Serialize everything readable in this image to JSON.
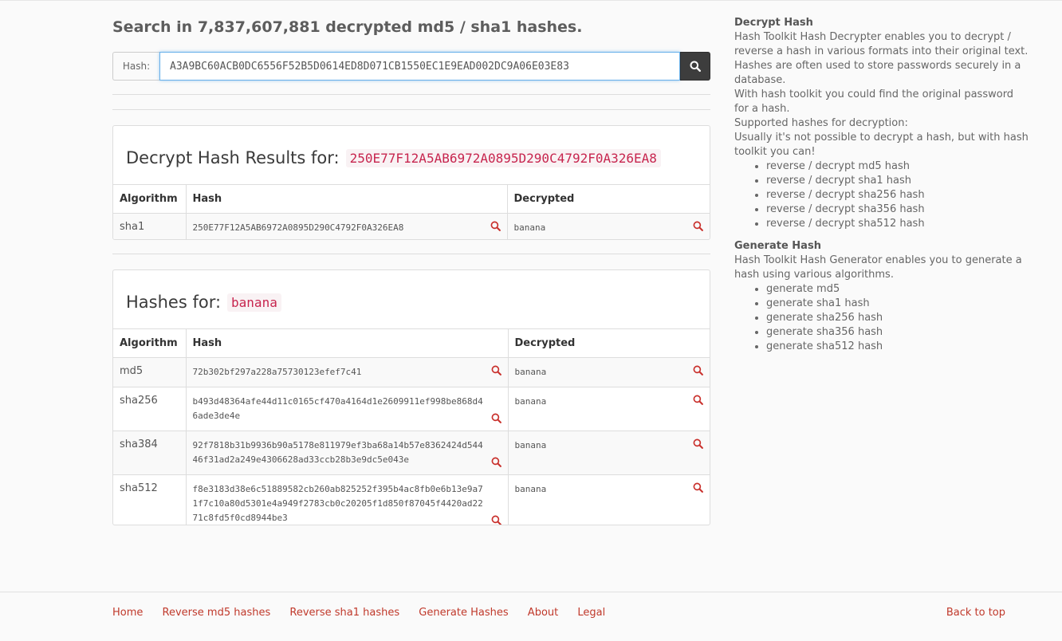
{
  "search": {
    "title": "Search in 7,837,607,881 decrypted md5 / sha1 hashes.",
    "label": "Hash:",
    "value": "A3A9BC60ACB0DC6556F52B5D0614ED8D071CB1550EC1E9EAD002DC9A06E03E83",
    "button_icon": "search-icon"
  },
  "decrypt_results": {
    "title": "Decrypt Hash Results for:",
    "query": "250E77F12A5AB6972A0895D290C4792F0A326EA8",
    "columns": [
      "Algorithm",
      "Hash",
      "Decrypted"
    ],
    "rows": [
      {
        "algorithm": "sha1",
        "hash": "250E77F12A5AB6972A0895D290C4792F0A326EA8",
        "decrypted": "banana"
      }
    ]
  },
  "hashes_for": {
    "title": "Hashes for:",
    "query": "banana",
    "columns": [
      "Algorithm",
      "Hash",
      "Decrypted"
    ],
    "rows": [
      {
        "algorithm": "md5",
        "hash": "72b302bf297a228a75730123efef7c41",
        "decrypted": "banana"
      },
      {
        "algorithm": "sha256",
        "hash": "b493d48364afe44d11c0165cf470a4164d1e2609911ef998be868d46ade3de4e",
        "decrypted": "banana"
      },
      {
        "algorithm": "sha384",
        "hash": "92f7818b31b9936b90a5178e811979ef3ba68a14b57e8362424d54446f31ad2a249e4306628ad33ccb28b3e9dc5e043e",
        "decrypted": "banana"
      },
      {
        "algorithm": "sha512",
        "hash": "f8e3183d38e6c51889582cb260ab825252f395b4ac8fb0e6b13e9a71f7c10a80d5301e4a949f2783cb0c20205f1d850f87045f4420ad2271c8fd5f0cd8944be3",
        "decrypted": "banana"
      }
    ]
  },
  "sidebar": {
    "decrypt_heading": "Decrypt Hash",
    "decrypt_p1": "Hash Toolkit Hash Decrypter enables you to decrypt / reverse a hash in various formats into their original text.",
    "decrypt_p2": "Hashes are often used to store passwords securely in a database.",
    "decrypt_p3": "With hash toolkit you could find the original password for a hash.",
    "decrypt_p4": "Supported hashes for decryption:",
    "decrypt_p5": "Usually it's not possible to decrypt a hash, but with hash toolkit you can!",
    "decrypt_items": [
      "reverse / decrypt md5 hash",
      "reverse / decrypt sha1 hash",
      "reverse / decrypt sha256 hash",
      "reverse / decrypt sha356 hash",
      "reverse / decrypt sha512 hash"
    ],
    "generate_heading": "Generate Hash",
    "generate_p1": "Hash Toolkit Hash Generator enables you to generate a hash using various algorithms.",
    "generate_items": [
      "generate md5",
      "generate sha1 hash",
      "generate sha256 hash",
      "generate sha356 hash",
      "generate sha512 hash"
    ]
  },
  "footer": {
    "links": [
      "Home",
      "Reverse md5 hashes",
      "Reverse sha1 hashes",
      "Generate Hashes",
      "About",
      "Legal"
    ],
    "back_to_top": "Back to top"
  },
  "colors": {
    "accent_red": "#c0392b",
    "code_red": "#c7254e",
    "button_dark": "#3d3d3d",
    "input_focus": "#66afe9"
  }
}
